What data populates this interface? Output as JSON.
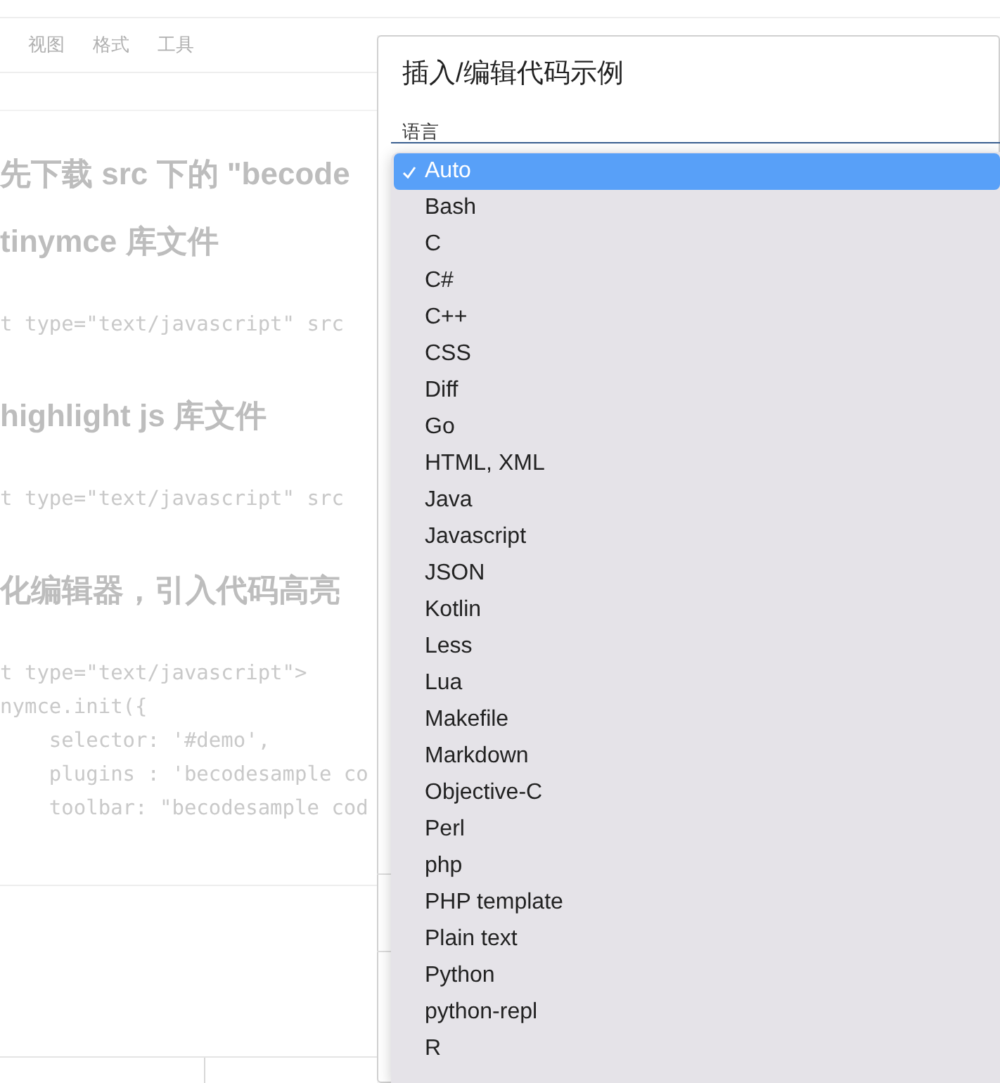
{
  "editor": {
    "menu": [
      "视图",
      "格式",
      "工具"
    ],
    "content": [
      {
        "kind": "heading",
        "text": "先下载 src 下的 \"becode"
      },
      {
        "kind": "heading",
        "text": "tinymce 库文件"
      },
      {
        "kind": "code",
        "lines": [
          "t type=\"text/javascript\" src"
        ]
      },
      {
        "kind": "heading",
        "text": "highlight js 库文件"
      },
      {
        "kind": "code",
        "lines": [
          "t type=\"text/javascript\" src"
        ]
      },
      {
        "kind": "heading",
        "text": "化编辑器，引入代码高亮"
      },
      {
        "kind": "code",
        "lines": [
          "t type=\"text/javascript\">",
          "nymce.init({",
          "    selector: '#demo',",
          "    plugins : 'becodesample co",
          "    toolbar: \"becodesample cod"
        ]
      }
    ]
  },
  "dialog": {
    "title": "插入/编辑代码示例",
    "field_label": "语言",
    "options": [
      {
        "label": "Auto",
        "selected": true
      },
      {
        "label": "Bash",
        "selected": false
      },
      {
        "label": "C",
        "selected": false
      },
      {
        "label": "C#",
        "selected": false
      },
      {
        "label": "C++",
        "selected": false
      },
      {
        "label": "CSS",
        "selected": false
      },
      {
        "label": "Diff",
        "selected": false
      },
      {
        "label": "Go",
        "selected": false
      },
      {
        "label": "HTML, XML",
        "selected": false
      },
      {
        "label": "Java",
        "selected": false
      },
      {
        "label": "Javascript",
        "selected": false
      },
      {
        "label": "JSON",
        "selected": false
      },
      {
        "label": "Kotlin",
        "selected": false
      },
      {
        "label": "Less",
        "selected": false
      },
      {
        "label": "Lua",
        "selected": false
      },
      {
        "label": "Makefile",
        "selected": false
      },
      {
        "label": "Markdown",
        "selected": false
      },
      {
        "label": "Objective-C",
        "selected": false
      },
      {
        "label": "Perl",
        "selected": false
      },
      {
        "label": "php",
        "selected": false
      },
      {
        "label": "PHP template",
        "selected": false
      },
      {
        "label": "Plain text",
        "selected": false
      },
      {
        "label": "Python",
        "selected": false
      },
      {
        "label": "python-repl",
        "selected": false
      },
      {
        "label": "R",
        "selected": false
      }
    ]
  }
}
